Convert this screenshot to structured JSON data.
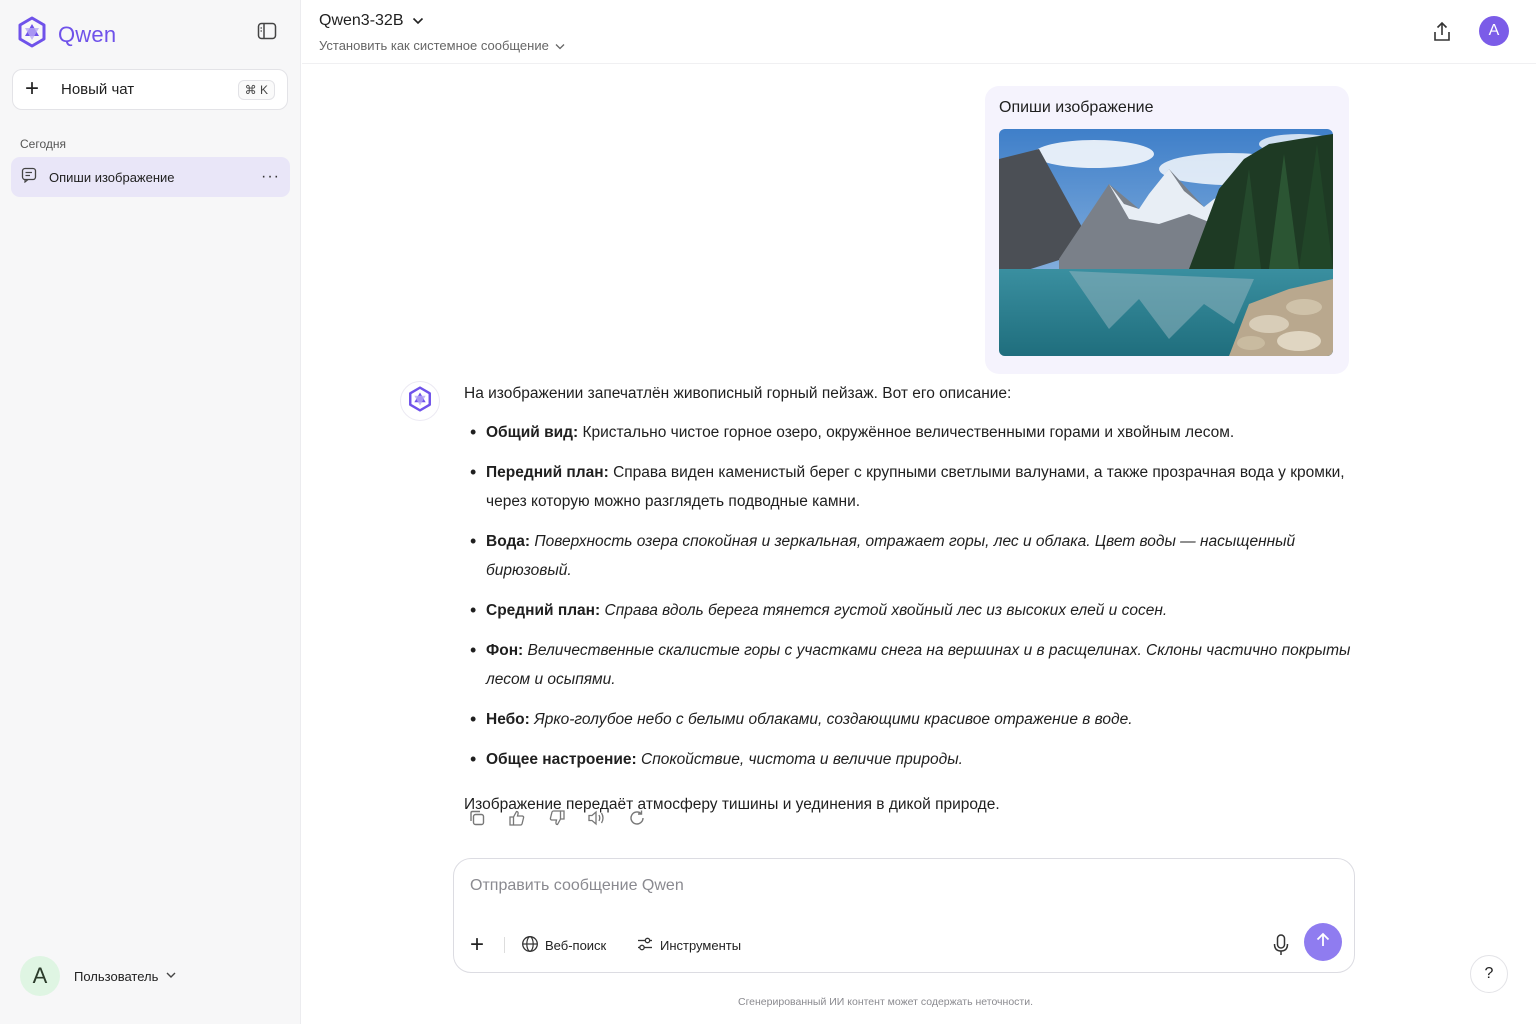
{
  "sidebar": {
    "brand": "Qwen",
    "new_chat_label": "Новый чат",
    "shortcut": "⌘ K",
    "section_label": "Сегодня",
    "chats": [
      {
        "title": "Опиши изображение"
      }
    ],
    "more_glyph": "···",
    "user": {
      "initial": "A",
      "name": "Пользователь"
    }
  },
  "header": {
    "model_name": "Qwen3-32B",
    "system_message_label": "Установить как системное сообщение",
    "avatar_initial": "A"
  },
  "conversation": {
    "user_message": "Опиши изображение",
    "assistant": {
      "intro": "На изображении запечатлён живописный горный пейзаж. Вот его описание:",
      "items": [
        {
          "label": "Общий вид:",
          "text": " Кристально чистое горное озеро, окружённое величественными горами и хвойным лесом.",
          "italic": false
        },
        {
          "label": "Передний план:",
          "text": " Справа виден каменистый берег с крупными светлыми валунами, а также прозрачная вода у кромки, через которую можно разглядеть подводные камни.",
          "italic": false
        },
        {
          "label": "Вода:",
          "text": " Поверхность озера спокойная и зеркальная, отражает горы, лес и облака. Цвет воды — насыщенный бирюзовый.",
          "italic": true
        },
        {
          "label": "Средний план:",
          "text": " Справа вдоль берега тянется густой хвойный лес из высоких елей и сосен.",
          "italic": true
        },
        {
          "label": "Фон:",
          "text": " Величественные скалистые горы с участками снега на вершинах и в расщелинах. Склоны частично покрыты лесом и осыпями.",
          "italic": true
        },
        {
          "label": "Небо:",
          "text": " Ярко-голубое небо с белыми облаками, создающими красивое отражение в воде.",
          "italic": true
        },
        {
          "label": "Общее настроение:",
          "text": " Спокойствие, чистота и величие природы.",
          "italic": true
        }
      ],
      "outro": "Изображение передаёт атмосферу тишины и уединения в дикой природе."
    }
  },
  "composer": {
    "placeholder": "Отправить сообщение Qwen",
    "web_search_label": "Веб-поиск",
    "tools_label": "Инструменты"
  },
  "help_label": "?",
  "disclaimer": "Сгенерированный ИИ контент может содержать неточности.",
  "colors": {
    "accent": "#6f52ea",
    "send": "#8f7cf0",
    "selected_chat": "#e9e6f8"
  }
}
